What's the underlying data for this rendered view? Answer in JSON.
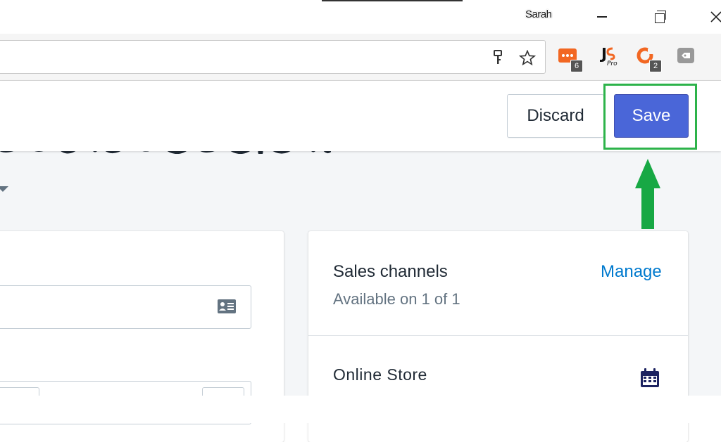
{
  "browser": {
    "profile_name": "Sarah",
    "window_controls": [
      "minimize-icon",
      "restore-icon",
      "close-icon"
    ],
    "omnibox_icons": [
      "key-icon",
      "star-icon"
    ],
    "extensions": [
      {
        "name": "dots-extension-icon",
        "badge": "6",
        "color": "#f26722"
      },
      {
        "name": "js-pro-extension-icon",
        "badge": "",
        "color": "#111111"
      },
      {
        "name": "ocean-extension-icon",
        "badge": "2",
        "color": "#f26722"
      },
      {
        "name": "tag-extension-icon",
        "badge": "",
        "color": "#888888"
      }
    ]
  },
  "header": {
    "discard_label": "Discard",
    "save_label": "Save"
  },
  "colors": {
    "save_button": "#4a66d8",
    "highlight": "#2db34a",
    "arrow": "#17a844",
    "link": "#007ace"
  },
  "sales_channels": {
    "title": "Sales channels",
    "manage_label": "Manage",
    "availability": "Available on 1 of 1",
    "channels": [
      {
        "name": "Online Store",
        "icon": "calendar-icon"
      }
    ]
  }
}
